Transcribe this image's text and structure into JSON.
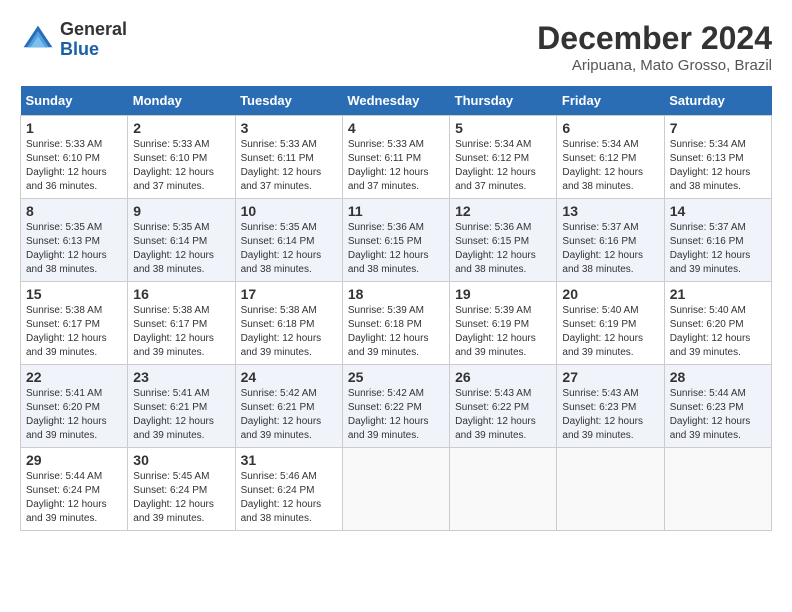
{
  "header": {
    "logo_general": "General",
    "logo_blue": "Blue",
    "month_title": "December 2024",
    "location": "Aripuana, Mato Grosso, Brazil"
  },
  "calendar": {
    "days_of_week": [
      "Sunday",
      "Monday",
      "Tuesday",
      "Wednesday",
      "Thursday",
      "Friday",
      "Saturday"
    ],
    "weeks": [
      [
        null,
        null,
        {
          "day": "3",
          "sunrise": "Sunrise: 5:33 AM",
          "sunset": "Sunset: 6:11 PM",
          "daylight": "Daylight: 12 hours and 37 minutes."
        },
        {
          "day": "4",
          "sunrise": "Sunrise: 5:33 AM",
          "sunset": "Sunset: 6:11 PM",
          "daylight": "Daylight: 12 hours and 37 minutes."
        },
        {
          "day": "5",
          "sunrise": "Sunrise: 5:34 AM",
          "sunset": "Sunset: 6:12 PM",
          "daylight": "Daylight: 12 hours and 37 minutes."
        },
        {
          "day": "6",
          "sunrise": "Sunrise: 5:34 AM",
          "sunset": "Sunset: 6:12 PM",
          "daylight": "Daylight: 12 hours and 38 minutes."
        },
        {
          "day": "7",
          "sunrise": "Sunrise: 5:34 AM",
          "sunset": "Sunset: 6:13 PM",
          "daylight": "Daylight: 12 hours and 38 minutes."
        }
      ],
      [
        {
          "day": "1",
          "sunrise": "Sunrise: 5:33 AM",
          "sunset": "Sunset: 6:10 PM",
          "daylight": "Daylight: 12 hours and 36 minutes."
        },
        {
          "day": "2",
          "sunrise": "Sunrise: 5:33 AM",
          "sunset": "Sunset: 6:10 PM",
          "daylight": "Daylight: 12 hours and 37 minutes."
        },
        null,
        null,
        null,
        null,
        null
      ],
      [
        {
          "day": "8",
          "sunrise": "Sunrise: 5:35 AM",
          "sunset": "Sunset: 6:13 PM",
          "daylight": "Daylight: 12 hours and 38 minutes."
        },
        {
          "day": "9",
          "sunrise": "Sunrise: 5:35 AM",
          "sunset": "Sunset: 6:14 PM",
          "daylight": "Daylight: 12 hours and 38 minutes."
        },
        {
          "day": "10",
          "sunrise": "Sunrise: 5:35 AM",
          "sunset": "Sunset: 6:14 PM",
          "daylight": "Daylight: 12 hours and 38 minutes."
        },
        {
          "day": "11",
          "sunrise": "Sunrise: 5:36 AM",
          "sunset": "Sunset: 6:15 PM",
          "daylight": "Daylight: 12 hours and 38 minutes."
        },
        {
          "day": "12",
          "sunrise": "Sunrise: 5:36 AM",
          "sunset": "Sunset: 6:15 PM",
          "daylight": "Daylight: 12 hours and 38 minutes."
        },
        {
          "day": "13",
          "sunrise": "Sunrise: 5:37 AM",
          "sunset": "Sunset: 6:16 PM",
          "daylight": "Daylight: 12 hours and 38 minutes."
        },
        {
          "day": "14",
          "sunrise": "Sunrise: 5:37 AM",
          "sunset": "Sunset: 6:16 PM",
          "daylight": "Daylight: 12 hours and 39 minutes."
        }
      ],
      [
        {
          "day": "15",
          "sunrise": "Sunrise: 5:38 AM",
          "sunset": "Sunset: 6:17 PM",
          "daylight": "Daylight: 12 hours and 39 minutes."
        },
        {
          "day": "16",
          "sunrise": "Sunrise: 5:38 AM",
          "sunset": "Sunset: 6:17 PM",
          "daylight": "Daylight: 12 hours and 39 minutes."
        },
        {
          "day": "17",
          "sunrise": "Sunrise: 5:38 AM",
          "sunset": "Sunset: 6:18 PM",
          "daylight": "Daylight: 12 hours and 39 minutes."
        },
        {
          "day": "18",
          "sunrise": "Sunrise: 5:39 AM",
          "sunset": "Sunset: 6:18 PM",
          "daylight": "Daylight: 12 hours and 39 minutes."
        },
        {
          "day": "19",
          "sunrise": "Sunrise: 5:39 AM",
          "sunset": "Sunset: 6:19 PM",
          "daylight": "Daylight: 12 hours and 39 minutes."
        },
        {
          "day": "20",
          "sunrise": "Sunrise: 5:40 AM",
          "sunset": "Sunset: 6:19 PM",
          "daylight": "Daylight: 12 hours and 39 minutes."
        },
        {
          "day": "21",
          "sunrise": "Sunrise: 5:40 AM",
          "sunset": "Sunset: 6:20 PM",
          "daylight": "Daylight: 12 hours and 39 minutes."
        }
      ],
      [
        {
          "day": "22",
          "sunrise": "Sunrise: 5:41 AM",
          "sunset": "Sunset: 6:20 PM",
          "daylight": "Daylight: 12 hours and 39 minutes."
        },
        {
          "day": "23",
          "sunrise": "Sunrise: 5:41 AM",
          "sunset": "Sunset: 6:21 PM",
          "daylight": "Daylight: 12 hours and 39 minutes."
        },
        {
          "day": "24",
          "sunrise": "Sunrise: 5:42 AM",
          "sunset": "Sunset: 6:21 PM",
          "daylight": "Daylight: 12 hours and 39 minutes."
        },
        {
          "day": "25",
          "sunrise": "Sunrise: 5:42 AM",
          "sunset": "Sunset: 6:22 PM",
          "daylight": "Daylight: 12 hours and 39 minutes."
        },
        {
          "day": "26",
          "sunrise": "Sunrise: 5:43 AM",
          "sunset": "Sunset: 6:22 PM",
          "daylight": "Daylight: 12 hours and 39 minutes."
        },
        {
          "day": "27",
          "sunrise": "Sunrise: 5:43 AM",
          "sunset": "Sunset: 6:23 PM",
          "daylight": "Daylight: 12 hours and 39 minutes."
        },
        {
          "day": "28",
          "sunrise": "Sunrise: 5:44 AM",
          "sunset": "Sunset: 6:23 PM",
          "daylight": "Daylight: 12 hours and 39 minutes."
        }
      ],
      [
        {
          "day": "29",
          "sunrise": "Sunrise: 5:44 AM",
          "sunset": "Sunset: 6:24 PM",
          "daylight": "Daylight: 12 hours and 39 minutes."
        },
        {
          "day": "30",
          "sunrise": "Sunrise: 5:45 AM",
          "sunset": "Sunset: 6:24 PM",
          "daylight": "Daylight: 12 hours and 39 minutes."
        },
        {
          "day": "31",
          "sunrise": "Sunrise: 5:46 AM",
          "sunset": "Sunset: 6:24 PM",
          "daylight": "Daylight: 12 hours and 38 minutes."
        },
        null,
        null,
        null,
        null
      ]
    ]
  }
}
